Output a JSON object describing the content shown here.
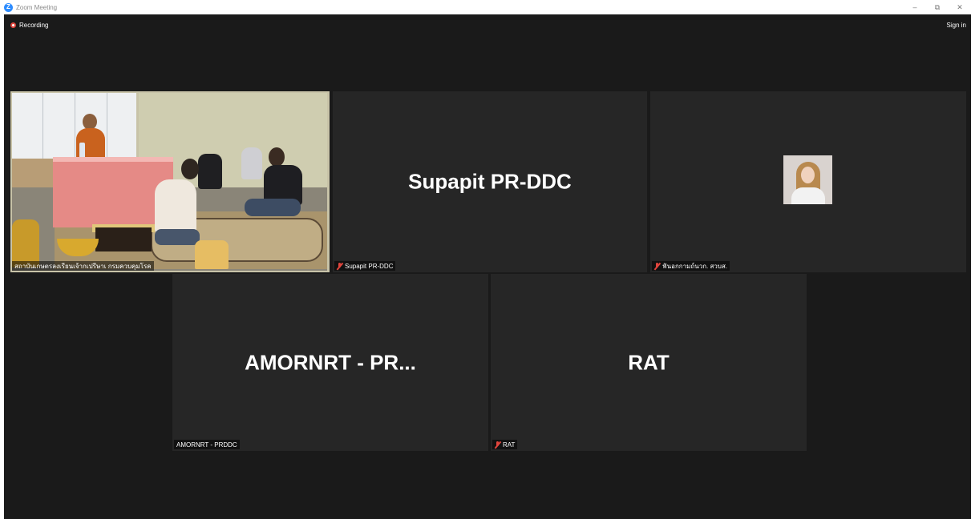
{
  "window": {
    "logo_letter": "Z",
    "title": "Zoom Meeting",
    "controls": {
      "minimize": "–",
      "restore": "⧉",
      "close": "✕"
    }
  },
  "status": {
    "recording_label": "Recording",
    "sign_in_label": "Sign in"
  },
  "tiles": [
    {
      "caption": "สถาบันเกษตรลงเรียนเจ้ากเปรีษาเ กรมควบคุมโรค",
      "big_name": "",
      "muted": false,
      "has_video": true,
      "active_speaker": true
    },
    {
      "caption": "Supapit PR-DDC",
      "big_name": "Supapit PR-DDC",
      "muted": true,
      "has_video": false,
      "active_speaker": false
    },
    {
      "caption": "ฟันอกกามถ์นวก. สวบส.",
      "big_name": "",
      "muted": true,
      "has_video": false,
      "has_avatar": true,
      "active_speaker": false
    },
    {
      "caption": "AMORNRT - PRDDC",
      "big_name": "AMORNRT - PR...",
      "muted": false,
      "has_video": false,
      "active_speaker": false
    },
    {
      "caption": "RAT",
      "big_name": "RAT",
      "muted": true,
      "has_video": false,
      "active_speaker": false
    }
  ],
  "colors": {
    "meeting_bg": "#1a1a1a",
    "tile_bg": "#262626",
    "active_speaker_border": "#c9e64a",
    "muted_icon": "#e0453d",
    "zoom_blue": "#2d8cff"
  }
}
